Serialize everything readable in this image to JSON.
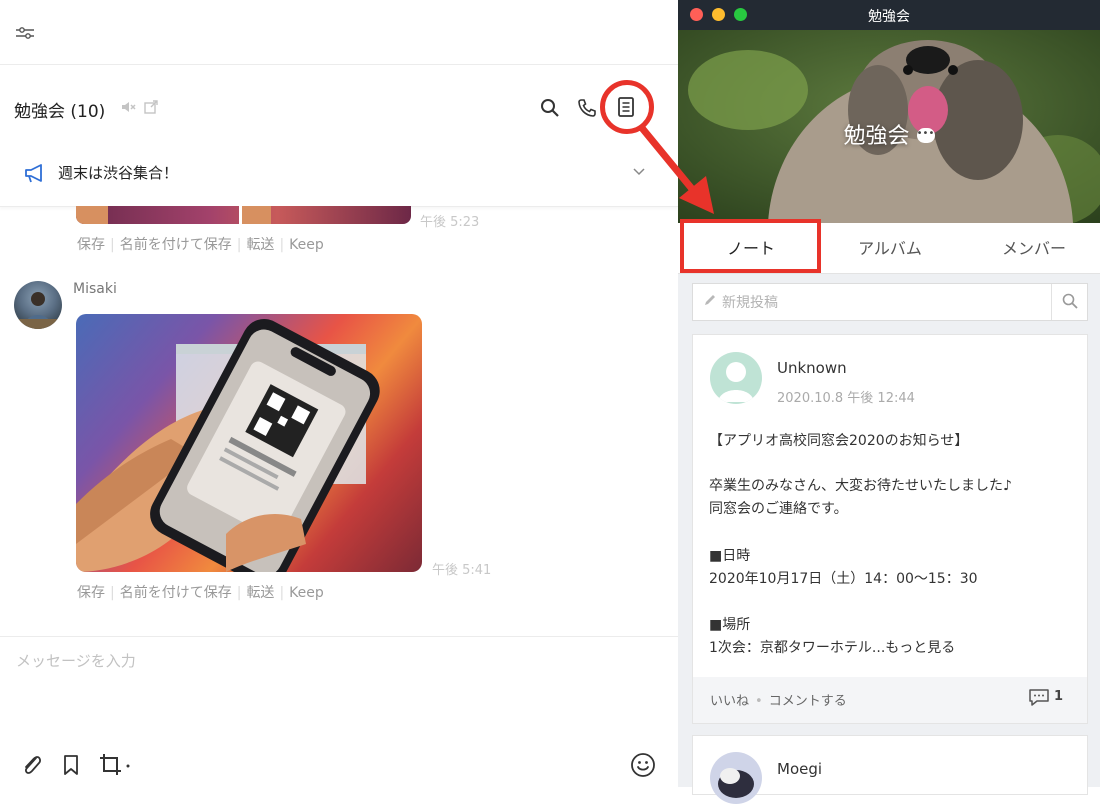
{
  "colors": {
    "highlight": "#e8332a",
    "titlebar": "#232a33",
    "traffic_red": "#ff5f57",
    "traffic_yellow": "#febc2e",
    "traffic_green": "#28c840"
  },
  "chat": {
    "title": "勉強会 (10)",
    "announcement": "週末は渋谷集合！",
    "messages": [
      {
        "time": "午後 5:23",
        "actions": [
          "保存",
          "名前を付けて保存",
          "転送",
          "Keep"
        ]
      },
      {
        "sender": "Misaki",
        "time": "午後 5:41",
        "actions": [
          "保存",
          "名前を付けて保存",
          "転送",
          "Keep"
        ]
      }
    ],
    "input_placeholder": "メッセージを入力",
    "icons": [
      "filter-icon",
      "mute-icon",
      "external-link-icon",
      "search-icon",
      "phone-icon",
      "notes-icon",
      "megaphone-icon",
      "chevron-down-icon",
      "paperclip-icon",
      "bookmark-icon",
      "crop-icon",
      "emoji-icon"
    ]
  },
  "note_window": {
    "title": "勉強会",
    "group_name": "勉強会",
    "tabs": [
      "ノート",
      "アルバム",
      "メンバー"
    ],
    "active_tab": "ノート",
    "search_placeholder": "新規投稿",
    "posts": [
      {
        "author": "Unknown",
        "date": "2020.10.8 午後 12:44",
        "lines": [
          "【アプリオ高校同窓会2020のお知らせ】",
          "",
          "卒業生のみなさん、大変お待たせいたしました♪",
          "同窓会のご連絡です。",
          "",
          "■日時",
          "2020年10月17日（土）14：00〜15：30",
          "",
          "■場所"
        ],
        "last_line": "1次会：京都タワーホテル",
        "more": "...もっと見る",
        "like": "いいね",
        "comment": "コメントする",
        "comment_count": "1"
      },
      {
        "author": "Moegi"
      }
    ]
  }
}
